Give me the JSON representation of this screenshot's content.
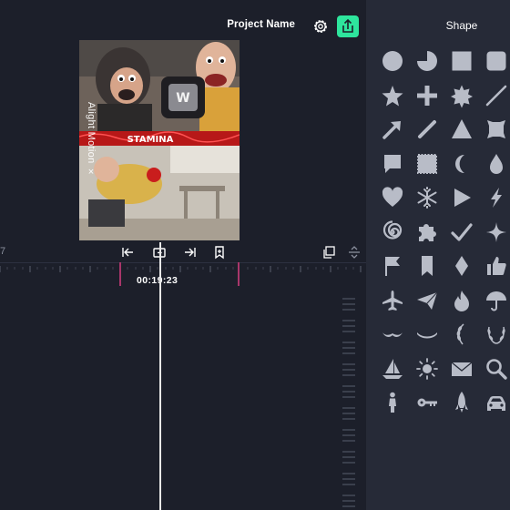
{
  "header": {
    "project_name": "Project Name"
  },
  "preview": {
    "watermark": "Alight Motion ×",
    "banner_text": "STAMINA"
  },
  "timeline": {
    "frame_number": "7",
    "timecode": "00:19:23"
  },
  "shape_panel": {
    "title": "Shape",
    "shapes": [
      "circle-icon",
      "pie-icon",
      "square-icon",
      "rounded-square-icon",
      "star-icon",
      "plus-icon",
      "badge-star-icon",
      "line-icon",
      "arrow-icon",
      "pen-line-icon",
      "triangle-icon",
      "octagon-frame-icon",
      "speech-bubble-icon",
      "stamp-icon",
      "crescent-icon",
      "drop-icon",
      "heart-icon",
      "snowflake-icon",
      "play-icon",
      "lightning-icon",
      "spiral-icon",
      "puzzle-icon",
      "checkmark-icon",
      "sparkle-icon",
      "flag-icon",
      "bookmark-icon",
      "diamond-icon",
      "thumbs-up-icon",
      "airplane-icon",
      "paper-plane-icon",
      "flame-icon",
      "umbrella-icon",
      "mustache-icon",
      "smile-icon",
      "laurel-left-icon",
      "laurel-icon",
      "sailboat-icon",
      "sun-icon",
      "envelope-icon",
      "magnifier-icon",
      "person-icon",
      "key-icon",
      "rocket-icon",
      "car-icon"
    ]
  },
  "colors": {
    "accent": "#2ee59d",
    "panel": "#262a37",
    "background": "#1c1f2a",
    "shape_fill": "#b8bcc7"
  }
}
